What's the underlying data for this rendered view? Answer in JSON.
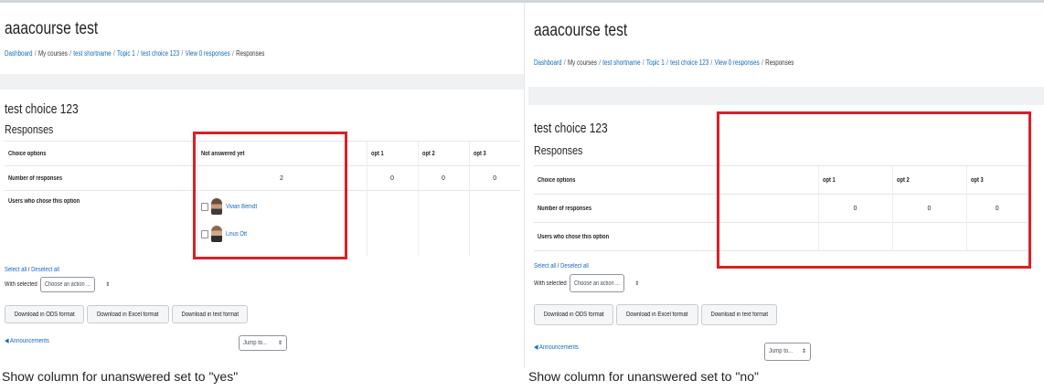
{
  "left": {
    "course_title": "aaacourse test",
    "breadcrumb": [
      {
        "label": "Dashboard",
        "link": true
      },
      {
        "label": "My courses",
        "link": false
      },
      {
        "label": "test shortname",
        "link": true
      },
      {
        "label": "Topic 1",
        "link": true
      },
      {
        "label": "test choice 123",
        "link": true
      },
      {
        "label": "View 0 responses",
        "link": true
      },
      {
        "label": "Responses",
        "link": false
      }
    ],
    "activity_title": "test choice 123",
    "responses_heading": "Responses",
    "table": {
      "header_label": "Choice options",
      "columns": [
        "Not answered yet",
        "opt 1",
        "opt 2",
        "opt 3"
      ],
      "count_label": "Number of responses",
      "counts": [
        "2",
        "0",
        "0",
        "0"
      ],
      "users_label": "Users who chose this option",
      "users": [
        "Vivian Berndt",
        "Linus Ott"
      ]
    },
    "select_all": "Select all",
    "deselect_all": "Deselect all",
    "with_selected": "With selected",
    "action_select": "Choose an action ...",
    "buttons": [
      "Download in ODS format",
      "Download in Excel format",
      "Download in text format"
    ],
    "announcements": "Announcements",
    "jump_to": "Jump to..."
  },
  "right": {
    "course_title": "aaacourse test",
    "breadcrumb": [
      {
        "label": "Dashboard",
        "link": true
      },
      {
        "label": "My courses",
        "link": false
      },
      {
        "label": "test shortname",
        "link": true
      },
      {
        "label": "Topic 1",
        "link": true
      },
      {
        "label": "test choice 123",
        "link": true
      },
      {
        "label": "View 0 responses",
        "link": true
      },
      {
        "label": "Responses",
        "link": false
      }
    ],
    "activity_title": "test choice 123",
    "responses_heading": "Responses",
    "table": {
      "header_label": "Choice options",
      "columns": [
        "opt 1",
        "opt 2",
        "opt 3"
      ],
      "count_label": "Number of responses",
      "counts": [
        "0",
        "0",
        "0"
      ],
      "users_label": "Users who chose this option"
    },
    "select_all": "Select all",
    "deselect_all": "Deselect all",
    "with_selected": "With selected",
    "action_select": "Choose an action ...",
    "buttons": [
      "Download in ODS format",
      "Download in Excel format",
      "Download in text format"
    ],
    "announcements": "Announcements",
    "jump_to": "Jump to..."
  },
  "captions": {
    "left": "Show column for unanswered set to \"yes\"",
    "right": "Show column for unanswered set to \"no\""
  },
  "colors": {
    "highlight": "#dc1f26",
    "link": "#0f6cbf"
  }
}
